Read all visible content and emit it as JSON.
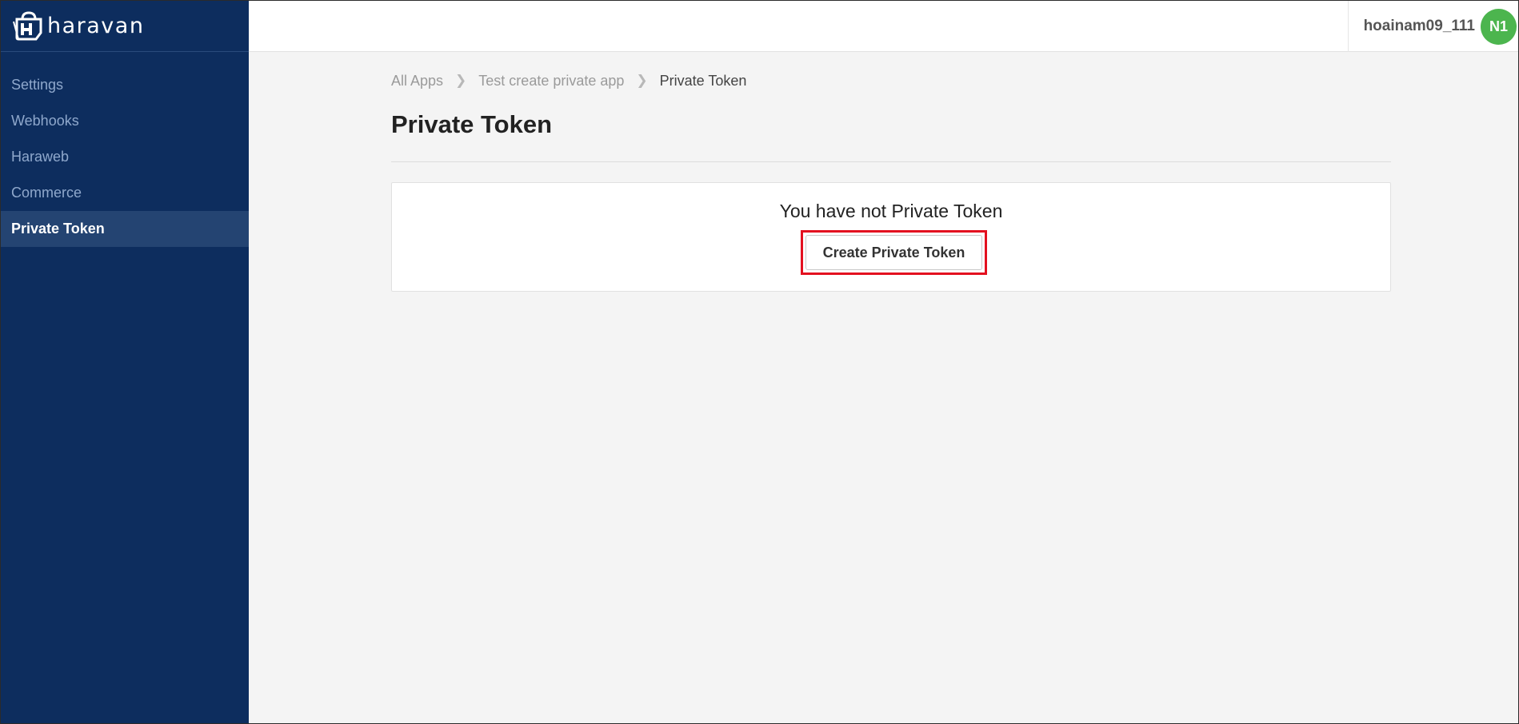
{
  "app": {
    "brand": "haravan"
  },
  "sidebar": {
    "items": [
      {
        "label": "Settings",
        "active": false
      },
      {
        "label": "Webhooks",
        "active": false
      },
      {
        "label": "Haraweb",
        "active": false
      },
      {
        "label": "Commerce",
        "active": false
      },
      {
        "label": "Private Token",
        "active": true
      }
    ]
  },
  "header": {
    "username": "hoainam09_111",
    "avatar_initials": "N1",
    "avatar_color": "#4cb54e"
  },
  "breadcrumb": {
    "items": [
      "All Apps",
      "Test create private app",
      "Private Token"
    ],
    "separator": ">"
  },
  "page": {
    "title": "Private Token",
    "empty_message": "You have not Private Token",
    "create_button_label": "Create Private Token"
  },
  "colors": {
    "sidebar_bg": "#0d2d5e",
    "active_item_bg": "#244472",
    "highlight_border": "#e3101f"
  }
}
